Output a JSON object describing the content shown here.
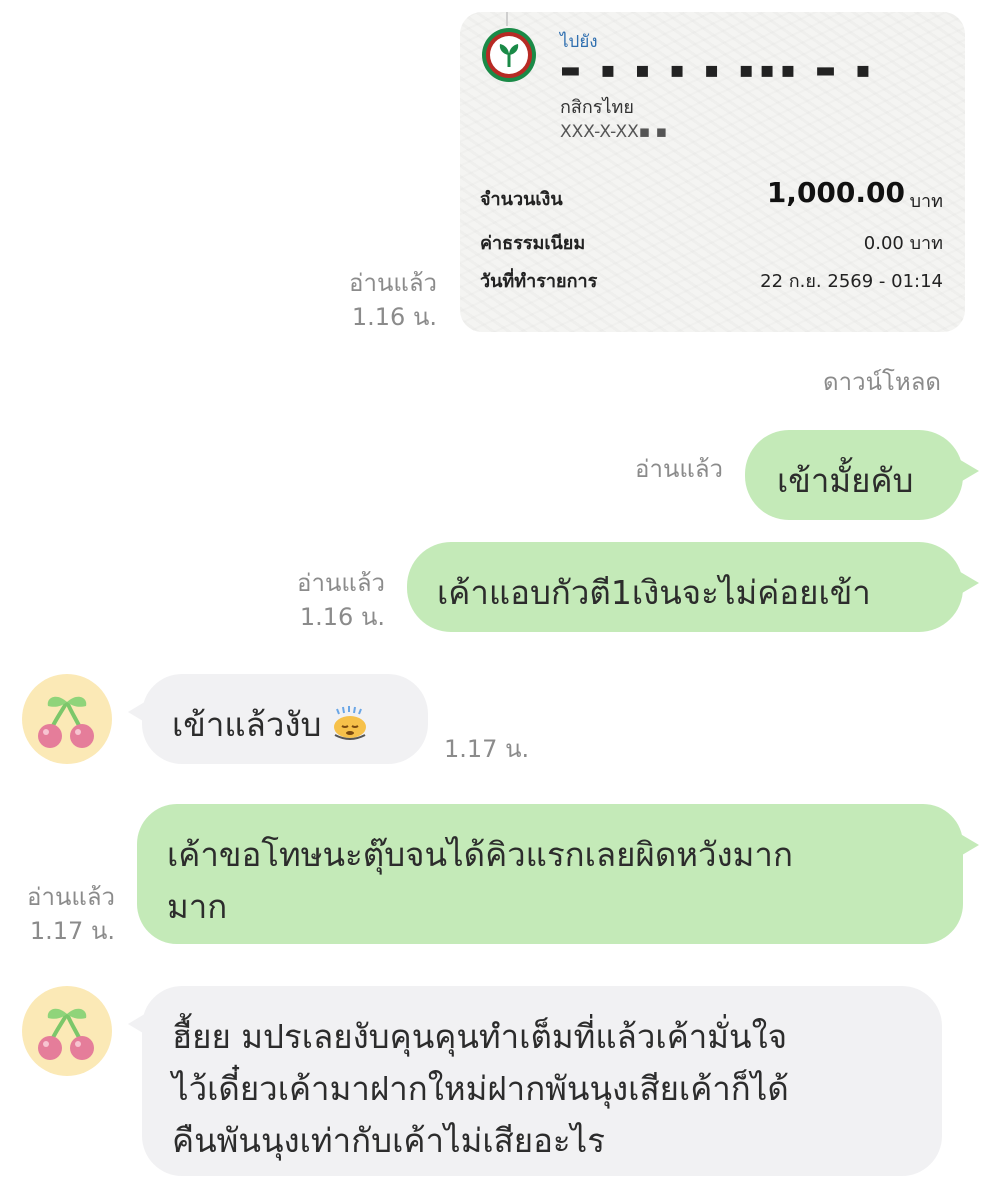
{
  "receipt": {
    "to_label": "ไปยัง",
    "recipient_masked": "▬ ▪ ▪ ▪  ▪ ▪▪▪ ▬ ▪",
    "bank": "กสิกรไทย",
    "account": "XXX-X-XX▪ ▪",
    "amount_label": "จำนวนเงิน",
    "amount": "1,000.00",
    "amount_unit": "บาท",
    "fee_label": "ค่าธรรมเนียม",
    "fee_value": "0.00 บาท",
    "date_label": "วันที่ทำรายการ",
    "date_value": "22 ก.ย. 2569 - 01:14",
    "bank_icon": "kasikorn-logo-icon"
  },
  "receipt_meta": {
    "read": "อ่านแล้ว",
    "time": "1.16 น."
  },
  "download_label": "ดาวน์โหลด",
  "messages": [
    {
      "side": "out",
      "text": "เข้ามั้ยคับ",
      "read": "อ่านแล้ว",
      "time": ""
    },
    {
      "side": "out",
      "text": "เค้าแอบกัวตี1เงินจะไม่ค่อยเข้า",
      "read": "อ่านแล้ว",
      "time": "1.16 น."
    },
    {
      "side": "in",
      "text": "เข้าแล้วงับ",
      "time": "1.17 น.",
      "emoji": "sweating-face-icon"
    },
    {
      "side": "out",
      "lines": [
        "เค้าขอโทษนะตุ๊บจนได้คิวแรกเลยผิดหวังมาก",
        "มาก"
      ],
      "read": "อ่านแล้ว",
      "time": "1.17 น."
    },
    {
      "side": "in",
      "lines": [
        "ฮื้ยย มปรเลยงับคุนคุนทำเต็มที่แล้วเค้ามั่นใจ",
        "ไว้เดี๋ยวเค้ามาฝากใหม่ฝากพันนุงเสียเค้าก็ได้",
        "คืนพันนุงเท่ากับเค้าไม่เสียอะไร"
      ]
    }
  ],
  "avatar_icon": "cherry-avatar-icon",
  "colors": {
    "outgoing_bubble": "#c4eab8",
    "incoming_bubble": "#f1f1f3",
    "meta_text": "#8b8b8b",
    "avatar_bg": "#fbe9b6"
  }
}
